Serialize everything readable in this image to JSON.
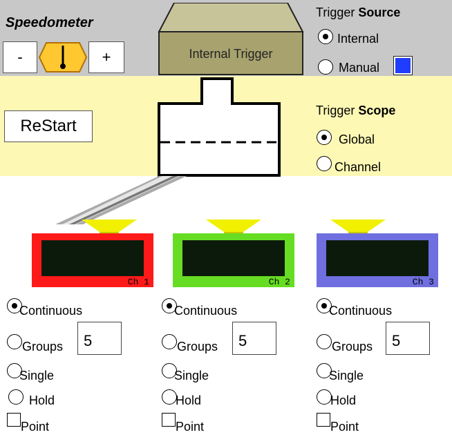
{
  "speedometer": {
    "title": "Speedometer",
    "minus_label": "-",
    "plus_label": "+"
  },
  "trigger_button": {
    "label": "Internal Trigger"
  },
  "trigger_source": {
    "title_prefix": "Trigger ",
    "title_bold": "Source",
    "options": [
      {
        "label": "Internal",
        "selected": true
      },
      {
        "label": "Manual",
        "selected": false
      }
    ],
    "manual_indicator_color": "#1f3cff"
  },
  "restart": {
    "label": "ReStart"
  },
  "trigger_scope": {
    "title_prefix": "Trigger ",
    "title_bold": "Scope",
    "options": [
      {
        "label": "Global",
        "selected": true
      },
      {
        "label": "Channel",
        "selected": false
      }
    ]
  },
  "channels": [
    {
      "name": "Ch 1",
      "color": "#ff1a1a",
      "modes": {
        "continuous": "Continuous",
        "groups": "Groups",
        "groups_value": "5",
        "single": "Single",
        "hold": "Hold",
        "point": "Point"
      },
      "selected_mode": "continuous"
    },
    {
      "name": "Ch 2",
      "color": "#66dd22",
      "modes": {
        "continuous": "Continuous",
        "groups": "Groups",
        "groups_value": "5",
        "single": "Single",
        "hold": "Hold",
        "point": "Point"
      },
      "selected_mode": "continuous"
    },
    {
      "name": "Ch 3",
      "color": "#6f6fe0",
      "modes": {
        "continuous": "Continuous",
        "groups": "Groups",
        "groups_value": "5",
        "single": "Single",
        "hold": "Hold",
        "point": "Point"
      },
      "selected_mode": "continuous"
    }
  ],
  "colors": {
    "top_band": "#c8c8c8",
    "middle_band": "#fdf8b4",
    "trigger_box": "#a8a26e",
    "dial": "#ffc830",
    "lamp": "#f0f000"
  },
  "icons": [
    "speedometer-dial-icon",
    "trigger-chamber-icon",
    "pipe-icon",
    "lamp-icon"
  ]
}
